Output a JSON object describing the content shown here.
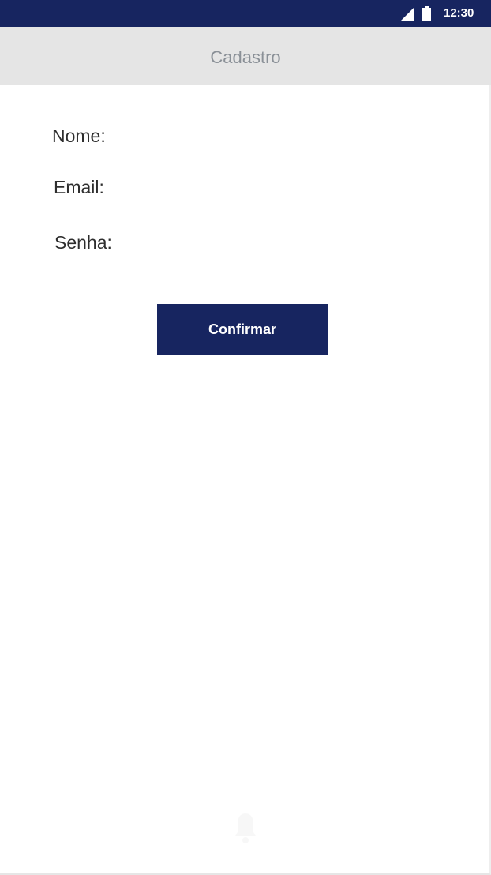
{
  "status_bar": {
    "time": "12:30",
    "signal_icon": "signal-icon",
    "battery_icon": "battery-icon",
    "background_color": "#172560"
  },
  "app_bar": {
    "title": "Cadastro",
    "background_color": "#e5e5e5"
  },
  "form": {
    "fields": [
      {
        "label": "Nome:",
        "value": "",
        "placeholder": ""
      },
      {
        "label": "Email:",
        "value": "",
        "placeholder": ""
      },
      {
        "label": "Senha:",
        "value": "",
        "placeholder": ""
      }
    ],
    "confirm_label": "Confirmar",
    "accent_color": "#172560"
  },
  "bottom": {
    "icon": "bell-icon"
  }
}
